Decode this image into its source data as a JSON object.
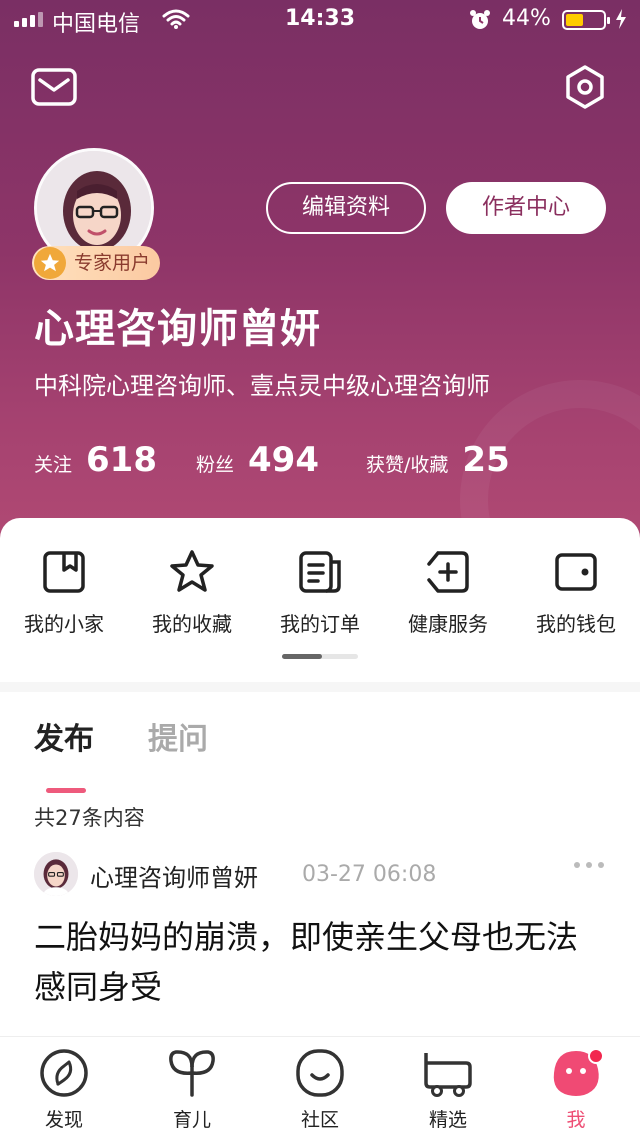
{
  "status_bar": {
    "carrier": "中国电信",
    "time": "14:33",
    "battery": "44%"
  },
  "header": {
    "mail_icon": "mail-icon",
    "settings_icon": "hexagon-settings-icon"
  },
  "profile": {
    "badge": "专家用户",
    "edit_button": "编辑资料",
    "author_button": "作者中心",
    "name": "心理咨询师曾妍",
    "description": "中科院心理咨询师、壹点灵中级心理咨询师",
    "stats": [
      {
        "label": "关注",
        "value": "618"
      },
      {
        "label": "粉丝",
        "value": "494"
      },
      {
        "label": "获赞/收藏",
        "value": "25"
      }
    ]
  },
  "services": {
    "items": [
      {
        "label": "我的小家",
        "icon": "bookmark-box-icon"
      },
      {
        "label": "我的收藏",
        "icon": "star-icon"
      },
      {
        "label": "我的订单",
        "icon": "order-icon"
      },
      {
        "label": "健康服务",
        "icon": "health-plus-icon"
      },
      {
        "label": "我的钱包",
        "icon": "wallet-icon"
      }
    ]
  },
  "content": {
    "tabs": [
      {
        "label": "发布",
        "active": true
      },
      {
        "label": "提问",
        "active": false
      }
    ],
    "count_text": "共27条内容",
    "post": {
      "author": "心理咨询师曾妍",
      "time": "03-27 06:08",
      "title": "二胎妈妈的崩溃，即使亲生父母也无法感同身受"
    }
  },
  "bottom_nav": {
    "items": [
      {
        "label": "发现",
        "icon": "compass-icon"
      },
      {
        "label": "育儿",
        "icon": "sprout-icon"
      },
      {
        "label": "社区",
        "icon": "smile-icon"
      },
      {
        "label": "精选",
        "icon": "cart-icon"
      },
      {
        "label": "我",
        "icon": "profile-blob-icon",
        "active": true
      }
    ]
  },
  "colors": {
    "header_gradient_top": "#7a2f64",
    "header_gradient_bottom": "#b24a74",
    "accent_pink": "#ee5a7c",
    "active_nav": "#ee4e74"
  }
}
